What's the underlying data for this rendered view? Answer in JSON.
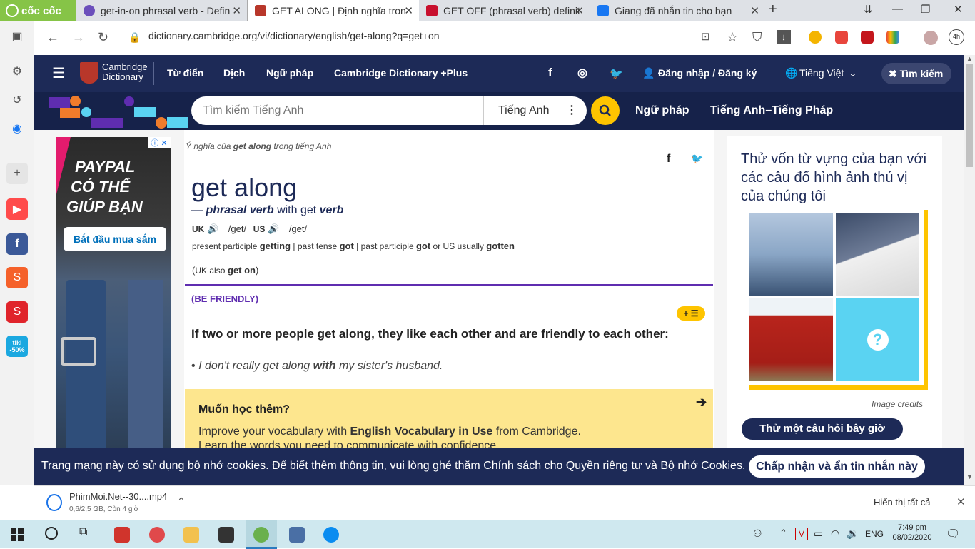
{
  "browser": {
    "brand": "cốc cốc",
    "tabs": [
      {
        "title": "get-in-on phrasal verb - Defin",
        "fav": "#6b4fbb"
      },
      {
        "title": "GET ALONG | Định nghĩa tron",
        "fav": "#b8372a",
        "active": true
      },
      {
        "title": "GET OFF (phrasal verb) definit",
        "fav": "#c8102e"
      },
      {
        "title": "Giang đã nhắn tin cho bạn",
        "fav": "#1877f2"
      }
    ],
    "url": "dictionary.cambridge.org/vi/dictionary/english/get-along?q=get+on"
  },
  "site": {
    "logo_line1": "Cambridge",
    "logo_line2": "Dictionary",
    "nav": [
      "Từ điển",
      "Dịch",
      "Ngữ pháp",
      "Cambridge Dictionary +Plus"
    ],
    "login": "Đăng nhập / Đăng ký",
    "language": "Tiếng Việt",
    "search_toggle": "Tìm kiếm",
    "search_placeholder": "Tìm kiếm Tiếng Anh",
    "search_scope": "Tiếng Anh",
    "links2": [
      "Ngữ pháp",
      "Tiếng Anh–Tiếng Pháp"
    ]
  },
  "ad": {
    "headline1": "PAYPAL",
    "headline2": "CÓ THỂ",
    "headline3": "GIÚP BẠN",
    "cta": "Bắt đầu mua sắm"
  },
  "entry": {
    "meaning_prefix": "Ý nghĩa của",
    "meaning_word": "get along",
    "meaning_suffix": "trong tiếng Anh",
    "headword": "get along",
    "dash": "—",
    "pos": "phrasal verb",
    "with_text": "with get",
    "verb": "verb",
    "uk": "UK",
    "uk_pron": "/get/",
    "us": "US",
    "us_pron": "/get/",
    "pp_label": "present participle",
    "pp": "getting",
    "pt_label": "past tense",
    "pt": "got",
    "pap_label": "past participle",
    "pap": "got",
    "or_us": "or US usually",
    "pap2": "gotten",
    "also_open": "(",
    "also_label": "UK also",
    "also_word": "get on",
    "also_close": ")",
    "guideword": "(BE FRIENDLY)",
    "definition": "If two or more people get along, they like each other and are friendly to each other:",
    "example_a": "I don't really get along",
    "example_b": "with",
    "example_c": "my sister's husband.",
    "learn_title": "Muốn học thêm?",
    "learn_line1a": "Improve your vocabulary with",
    "learn_line1b": "English Vocabulary in Use",
    "learn_line1c": "from Cambridge.",
    "learn_line2": "Learn the words you need to communicate with confidence."
  },
  "quiz": {
    "title": "Thử vốn từ vựng của bạn với các câu đố hình ảnh thú vị của chúng tôi",
    "credits": "Image credits",
    "button": "Thử một câu hỏi bây giờ"
  },
  "cookie": {
    "text": "Trang mạng này có sử dụng bộ nhớ cookies. Để biết thêm thông tin, vui lòng ghé thăm",
    "link": "Chính sách cho Quyền riêng tư và Bộ nhớ Cookies",
    "period": ".",
    "button": "Chấp nhận và ẩn tin nhắn này"
  },
  "download": {
    "filename": "PhimMoi.Net--30....mp4",
    "status": "0,6/2,5 GB, Còn 4 giờ",
    "show_all": "Hiển thị tất cả"
  },
  "taskbar": {
    "lang": "ENG",
    "time": "7:49 pm",
    "date": "08/02/2020"
  },
  "colors": {
    "navy": "#1d2a57",
    "yellow": "#fec400",
    "purple": "#5f2db0"
  }
}
